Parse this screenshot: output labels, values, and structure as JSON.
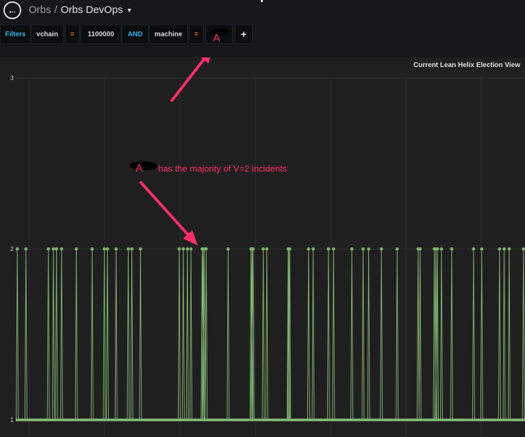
{
  "header": {
    "back_icon": "arrow-left-icon",
    "folder": "Orbs",
    "separator": "/",
    "dashboard": "Orbs DevOps",
    "caret_icon": "caret-down-icon"
  },
  "filters": {
    "segments": [
      {
        "text": "Filters",
        "kind": "keyword"
      },
      {
        "text": "vchain",
        "kind": "key"
      },
      {
        "text": "=",
        "kind": "operator"
      },
      {
        "text": "1100000",
        "kind": "value"
      },
      {
        "text": "AND",
        "kind": "keyword"
      },
      {
        "text": "machine",
        "kind": "key"
      },
      {
        "text": "=",
        "kind": "operator"
      },
      {
        "text": "A",
        "kind": "masked-value"
      },
      {
        "text": "+",
        "kind": "add"
      }
    ]
  },
  "panel": {
    "title": "Current Lean Helix Election View"
  },
  "annotation": {
    "letter": "A",
    "text": "has the majority of V=2 incidents",
    "color": "#ff2d6a"
  },
  "colors": {
    "series": "#7eb26d",
    "annotation": "#ff2d6a",
    "keyword": "#33b5e5",
    "operator": "#eb7b18",
    "background": "#161719",
    "panel": "#1f1f20"
  },
  "chart_data": {
    "type": "line",
    "title": "Current Lean Helix Election View",
    "xlabel": "",
    "ylabel": "",
    "ylim": [
      1,
      3
    ],
    "yticks": [
      1,
      2,
      3
    ],
    "grid": true,
    "legend": "none",
    "series": [
      {
        "color": "#7eb26d",
        "baseline": 1,
        "spike_value": 2,
        "spike_positions": [
          0.003,
          0.02,
          0.064,
          0.074,
          0.08,
          0.09,
          0.119,
          0.15,
          0.174,
          0.18,
          0.197,
          0.221,
          0.228,
          0.245,
          0.321,
          0.329,
          0.337,
          0.344,
          0.366,
          0.368,
          0.37,
          0.374,
          0.417,
          0.462,
          0.464,
          0.466,
          0.486,
          0.493,
          0.535,
          0.536,
          0.538,
          0.575,
          0.584,
          0.614,
          0.624,
          0.66,
          0.682,
          0.693,
          0.718,
          0.749,
          0.79,
          0.794,
          0.822,
          0.825,
          0.828,
          0.836,
          0.856,
          0.899,
          0.915,
          0.95,
          0.959,
          0.969,
          0.997
        ]
      }
    ]
  }
}
